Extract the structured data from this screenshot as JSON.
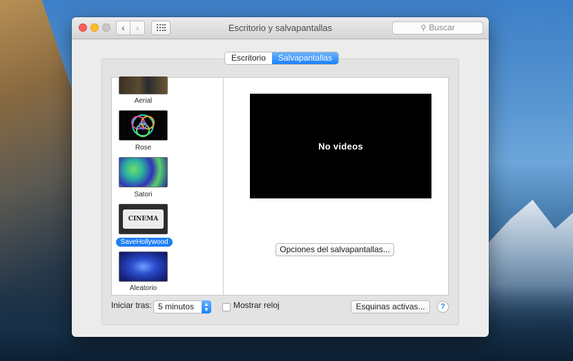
{
  "window": {
    "title": "Escritorio y salvapantallas",
    "search_placeholder": "Buscar"
  },
  "icons": {
    "back": "chevron-left-icon",
    "forward": "chevron-right-icon",
    "grid": "grid-icon",
    "search": "magnifier-icon",
    "help": "question-icon"
  },
  "tabs": [
    {
      "label": "Escritorio",
      "active": false
    },
    {
      "label": "Salvapantallas",
      "active": true
    }
  ],
  "savers": [
    {
      "name": "Aerial",
      "selected": false
    },
    {
      "name": "Rose",
      "selected": false
    },
    {
      "name": "Satori",
      "selected": false
    },
    {
      "name": "SaveHollywood",
      "selected": true,
      "thumb_text": "CINEMA"
    },
    {
      "name": "Aleatorio",
      "selected": false
    }
  ],
  "preview": {
    "message": "No videos"
  },
  "options_button": "Opciones del salvapantallas...",
  "bottom": {
    "start_label": "Iniciar tras:",
    "start_value": "5 minutos",
    "show_clock_label": "Mostrar reloj",
    "show_clock_checked": false,
    "hot_corners_button": "Esquinas activas...",
    "help_glyph": "?"
  },
  "colors": {
    "accent": "#1a82fb",
    "close": "#fc5f57",
    "minimize": "#fdbc2e",
    "maximize_disabled": "#c8c8c8"
  }
}
